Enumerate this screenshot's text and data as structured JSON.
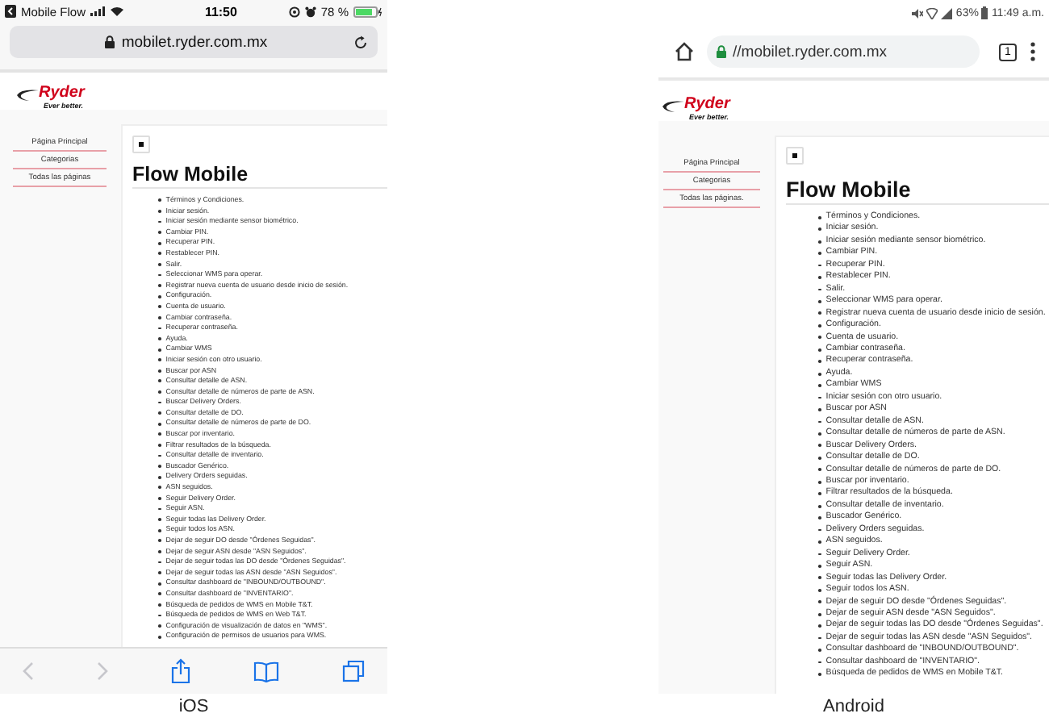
{
  "phones": [
    {
      "kind": "ios",
      "status_bar": {
        "carrier": "Mobile Flow",
        "time": "11:50",
        "battery": "78 %"
      },
      "url": "mobilet.ryder.com.mx",
      "logo": {
        "name": "Ryder",
        "tagline": "Ever better."
      },
      "nav": [
        "Página Principal",
        "Categorias",
        "Todas las páginas"
      ],
      "title": "Flow Mobile",
      "items": [
        "Términos y Condiciones.",
        "Iniciar sesión.",
        "Iniciar sesión mediante sensor biométrico.",
        "Cambiar PIN.",
        "Recuperar PIN.",
        "Restablecer PIN.",
        "Salir.",
        "Seleccionar WMS para operar.",
        "Registrar nueva cuenta de usuario desde inicio de sesión.",
        "Configuración.",
        "Cuenta de usuario.",
        "Cambiar contraseña.",
        "Recuperar contraseña.",
        "Ayuda.",
        "Cambiar WMS",
        "Iniciar sesión con otro usuario.",
        "Buscar por ASN",
        "Consultar detalle de ASN.",
        "Consultar detalle de números de parte de ASN.",
        "Buscar Delivery Orders.",
        "Consultar detalle de DO.",
        "Consultar detalle de números de parte de DO.",
        "Buscar por inventario.",
        "Filtrar resultados de la búsqueda.",
        "Consultar detalle de inventario.",
        "Buscador Genérico.",
        "Delivery Orders seguidas.",
        "ASN seguidos.",
        "Seguir Delivery Order.",
        "Seguir ASN.",
        "Seguir todas las Delivery Order.",
        "Seguir todos los ASN.",
        "Dejar de seguir DO desde \"Órdenes Seguidas\".",
        "Dejar de seguir ASN desde \"ASN Seguidos\".",
        "Dejar de seguir todas las DO desde \"Órdenes Seguidas\".",
        "Dejar de seguir todas las ASN desde \"ASN Seguidos\".",
        "Consultar dashboard de \"INBOUND/OUTBOUND\".",
        "Consultar dashboard de \"INVENTARIO\".",
        "Búsqueda de pedidos de WMS en Mobile T&T.",
        "Búsqueda de pedidos de WMS en Web T&T.",
        "Configuración de visualización de datos en \"WMS\".",
        "Configuración de permisos de usuarios para WMS."
      ],
      "caption": "iOS"
    },
    {
      "kind": "android",
      "status_bar": {
        "battery": "63%",
        "time": "11:49 a.m."
      },
      "url": "//mobilet.ryder.com.mx",
      "tab_count": "1",
      "logo": {
        "name": "Ryder",
        "tagline": "Ever better."
      },
      "nav": [
        "Página Principal",
        "Categorias",
        "Todas las páginas."
      ],
      "title": "Flow Mobile",
      "items": [
        "Términos y Condiciones.",
        "Iniciar sesión.",
        "Iniciar sesión mediante sensor biométrico.",
        "Cambiar PIN.",
        "Recuperar PIN.",
        "Restablecer PIN.",
        "Salir.",
        "Seleccionar WMS para operar.",
        "Registrar nueva cuenta de usuario desde inicio de sesión.",
        "Configuración.",
        "Cuenta de usuario.",
        "Cambiar contraseña.",
        "Recuperar contraseña.",
        "Ayuda.",
        "Cambiar WMS",
        "Iniciar sesión con otro usuario.",
        "Buscar por ASN",
        "Consultar detalle de ASN.",
        "Consultar detalle de números de parte de ASN.",
        "Buscar Delivery Orders.",
        "Consultar detalle de DO.",
        "Consultar detalle de números de parte de DO.",
        "Buscar por inventario.",
        "Filtrar resultados de la búsqueda.",
        "Consultar detalle de inventario.",
        "Buscador Genérico.",
        "Delivery Orders seguidas.",
        "ASN seguidos.",
        "Seguir Delivery Order.",
        "Seguir ASN.",
        "Seguir todas las Delivery Order.",
        "Seguir todos los ASN.",
        "Dejar de seguir DO desde \"Órdenes Seguidas\".",
        "Dejar de seguir ASN desde \"ASN Seguidos\".",
        "Dejar de seguir todas las DO desde \"Órdenes Seguidas\".",
        "Dejar de seguir todas las ASN desde \"ASN Seguidos\".",
        "Consultar dashboard de \"INBOUND/OUTBOUND\".",
        "Consultar dashboard de \"INVENTARIO\".",
        "Búsqueda de pedidos de WMS en Mobile T&T."
      ],
      "caption": "Android"
    }
  ]
}
